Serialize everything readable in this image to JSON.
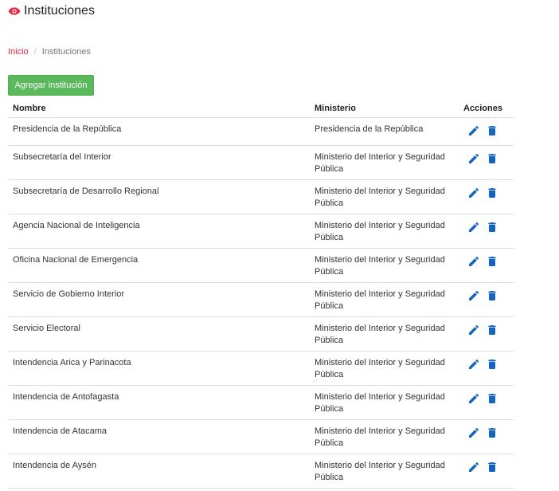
{
  "header": {
    "title": "Instituciones",
    "icon": "eye-icon"
  },
  "breadcrumb": {
    "home": "Inicio",
    "separator": "/",
    "current": "Instituciones"
  },
  "toolbar": {
    "add_label": "Agregar institución"
  },
  "table": {
    "columns": {
      "nombre": "Nombre",
      "ministerio": "Ministerio",
      "acciones": "Acciones"
    },
    "rows": [
      {
        "nombre": "Presidencia de la República",
        "ministerio": "Presidencia de la República"
      },
      {
        "nombre": "Subsecretaría del Interior",
        "ministerio": "Ministerio del Interior y Seguridad Pública"
      },
      {
        "nombre": "Subsecretaría de Desarrollo Regional",
        "ministerio": "Ministerio del Interior y Seguridad Pública"
      },
      {
        "nombre": "Agencia Nacional de Inteligencia",
        "ministerio": "Ministerio del Interior y Seguridad Pública"
      },
      {
        "nombre": "Oficina Nacional de Emergencia",
        "ministerio": "Ministerio del Interior y Seguridad Pública"
      },
      {
        "nombre": "Servicio de Gobierno Interior",
        "ministerio": "Ministerio del Interior y Seguridad Pública"
      },
      {
        "nombre": "Servicio Electoral",
        "ministerio": "Ministerio del Interior y Seguridad Pública"
      },
      {
        "nombre": "Intendencia Arica y Parinacota",
        "ministerio": "Ministerio del Interior y Seguridad Pública"
      },
      {
        "nombre": "Intendencia de Antofagasta",
        "ministerio": "Ministerio del Interior y Seguridad Pública"
      },
      {
        "nombre": "Intendencia de Atacama",
        "ministerio": "Ministerio del Interior y Seguridad Pública"
      },
      {
        "nombre": "Intendencia de Aysén",
        "ministerio": "Ministerio del Interior y Seguridad Pública"
      }
    ],
    "row_actions": [
      "edit-icon",
      "delete-icon"
    ]
  },
  "colors": {
    "accent": "#e8293f",
    "action_blue": "#1565c0",
    "success": "#5cb85c"
  }
}
